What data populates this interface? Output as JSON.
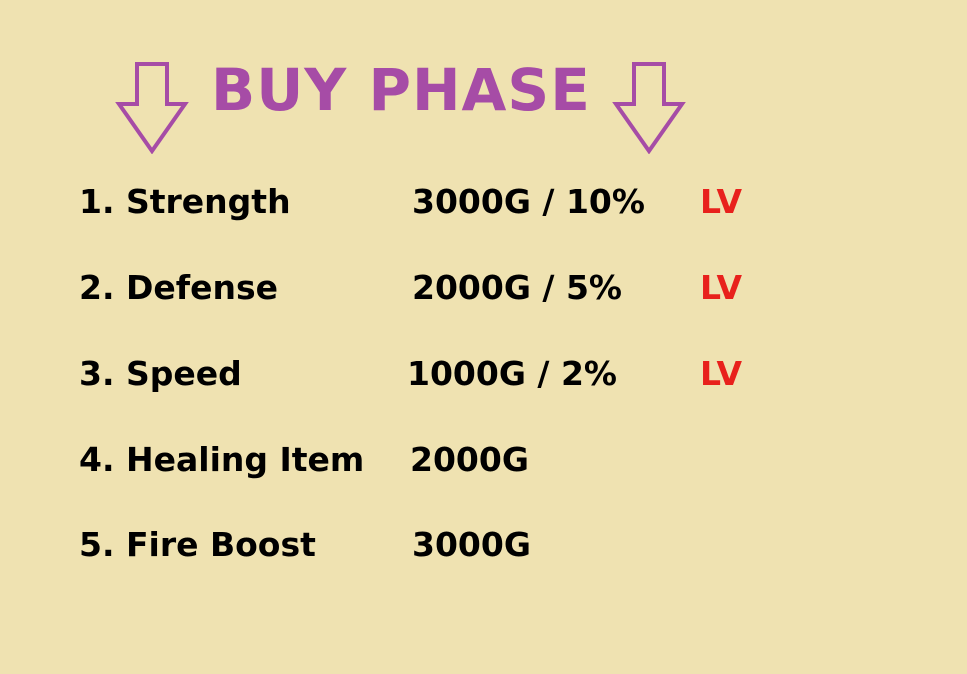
{
  "header": {
    "title": "BUY PHASE"
  },
  "colors": {
    "background": "#EFE2B1",
    "title": "#A64CA6",
    "arrow": "#A64CA6",
    "text": "#000000",
    "level": "#E8211C"
  },
  "icons": [
    "arrow-down-icon",
    "arrow-down-icon"
  ],
  "shop": {
    "items": [
      {
        "name": "1. Strength",
        "price": "3000G / 10%",
        "level": "LV"
      },
      {
        "name": "2. Defense",
        "price": "2000G / 5%",
        "level": "LV"
      },
      {
        "name": "3. Speed",
        "price": "1000G / 2%",
        "level": "LV"
      },
      {
        "name": "4. Healing Item",
        "price": "2000G"
      },
      {
        "name": "5. Fire Boost",
        "price": "3000G"
      }
    ]
  }
}
